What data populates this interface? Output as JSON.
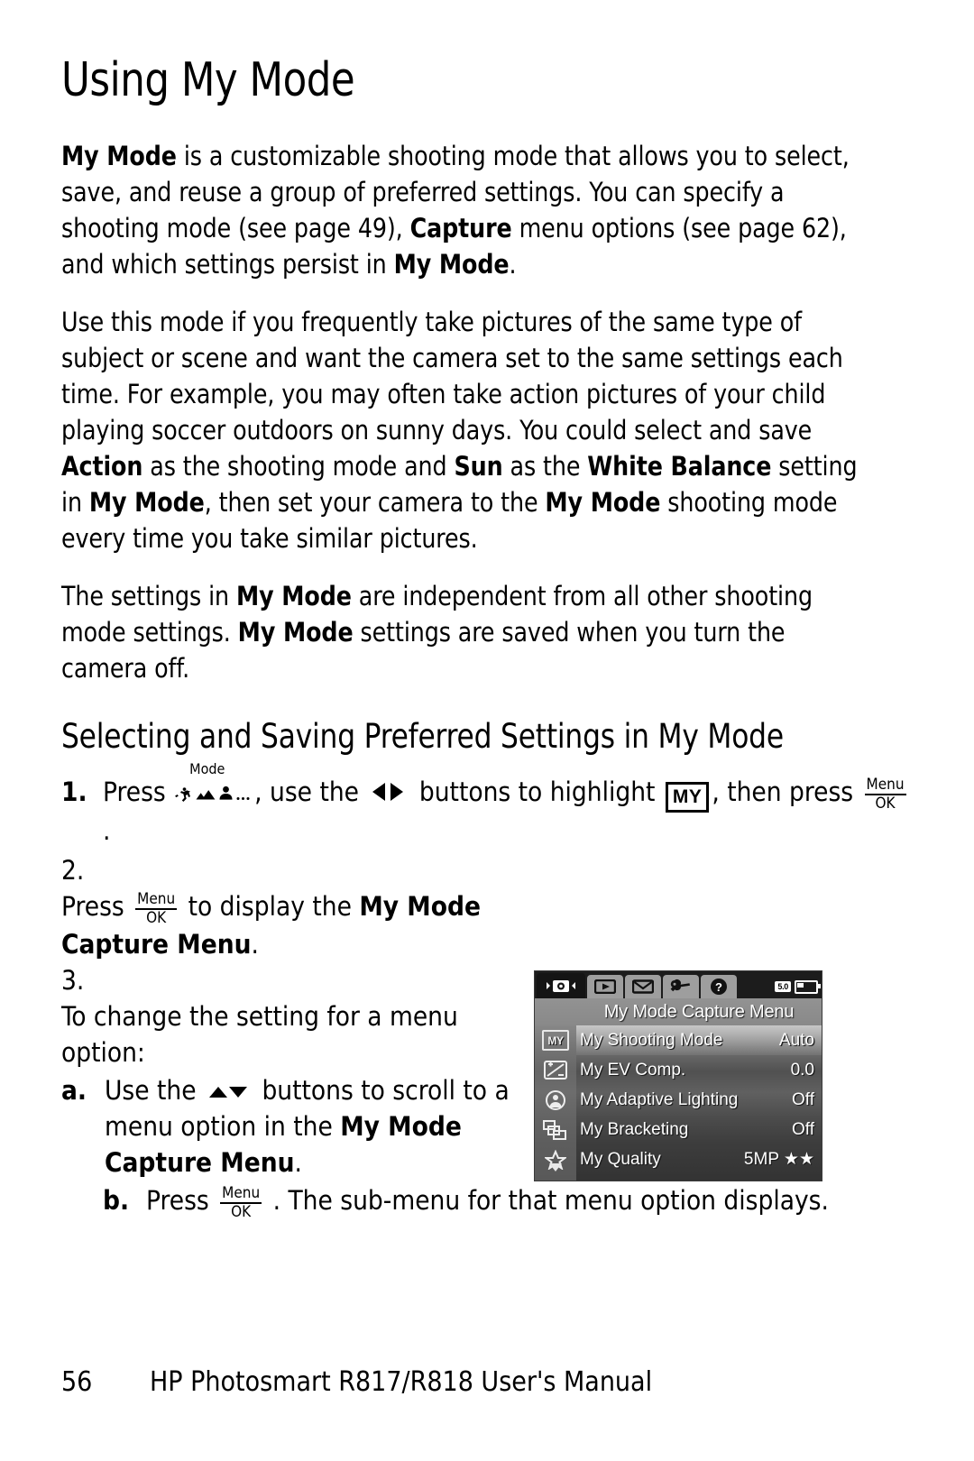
{
  "page": {
    "title": "Using My Mode",
    "section_title": "Selecting and Saving Preferred Settings in My Mode",
    "footer_page_number": "56",
    "footer_text": "HP Photosmart R817/R818 User's Manual"
  },
  "paragraphs": {
    "p1_a": "My Mode",
    "p1_b": " is a customizable shooting mode that allows you to select, save, and reuse a group of preferred settings. You can specify a shooting mode (see page 49), ",
    "p1_c": "Capture",
    "p1_d": " menu options (see page 62), and which settings persist in ",
    "p1_e": "My Mode",
    "p1_f": ".",
    "p2_a": "Use this mode if you frequently take pictures of the same type of subject or scene and want the camera set to the same settings each time. For example, you may often take action pictures of your child playing soccer outdoors on sunny days. You could select and save ",
    "p2_b": "Action",
    "p2_c": " as the shooting mode and ",
    "p2_d": "Sun",
    "p2_e": " as the ",
    "p2_f": "White Balance",
    "p2_g": " setting in ",
    "p2_h": "My Mode",
    "p2_i": ", then set your camera to the ",
    "p2_j": "My Mode",
    "p2_k": " shooting mode every time you take similar pictures.",
    "p3_a": "The settings in ",
    "p3_b": "My Mode",
    "p3_c": " are independent from all other shooting mode settings. ",
    "p3_d": "My Mode",
    "p3_e": " settings are saved when you turn the camera off."
  },
  "steps": {
    "s1_marker": "1.",
    "s1_t1": "Press ",
    "s1_t2": ", use the ",
    "s1_t3": " buttons to highlight ",
    "s1_t4": ", then press ",
    "s1_t5": " .",
    "s2_marker": "2.",
    "s2_t1": "Press ",
    "s2_t2": " to display the ",
    "s2_bold": "My Mode Capture Menu",
    "s2_t3": ".",
    "s3_marker": "3.",
    "s3_t1": "To change the setting for a menu option:",
    "sa_marker": "a.",
    "sa_t1": "Use the ",
    "sa_t2": " buttons to scroll to a menu option in the ",
    "sa_bold": "My Mode Capture Menu",
    "sa_t3": ".",
    "sb_marker": "b.",
    "sb_t1": "Press ",
    "sb_t2": " . The sub-menu for that menu option displays."
  },
  "icons": {
    "mode_label": "Mode",
    "menu_top": "Menu",
    "menu_bottom": "OK",
    "my_badge": "MY",
    "mode_icon_name": "mode-button-icon",
    "arrows_lr_name": "left-right-arrows-icon",
    "arrows_ud_name": "up-down-arrows-icon"
  },
  "camera_screen": {
    "menu_title": "My Mode Capture Menu",
    "tabs": [
      {
        "name": "capture-tab",
        "icon": "camera-icon",
        "active": true
      },
      {
        "name": "playback-tab",
        "icon": "play-icon",
        "active": false
      },
      {
        "name": "share-tab",
        "icon": "envelope-icon",
        "active": false
      },
      {
        "name": "setup-tab",
        "icon": "wrench-icon",
        "active": false
      },
      {
        "name": "help-tab",
        "icon": "question-icon",
        "active": false
      }
    ],
    "status": {
      "card": "5.0",
      "battery": "battery-icon"
    },
    "rows": [
      {
        "icon": "my-icon",
        "label": "My Shooting Mode",
        "value": "Auto",
        "selected": true
      },
      {
        "icon": "ev-comp-icon",
        "label": "My EV Comp.",
        "value": "0.0",
        "selected": false
      },
      {
        "icon": "adaptive-lighting-icon",
        "label": "My Adaptive Lighting",
        "value": "Off",
        "selected": false
      },
      {
        "icon": "bracketing-icon",
        "label": "My Bracketing",
        "value": "Off",
        "selected": false
      },
      {
        "icon": "quality-star-icon",
        "label": "My Quality",
        "value": "5MP ★★",
        "selected": false
      }
    ]
  }
}
